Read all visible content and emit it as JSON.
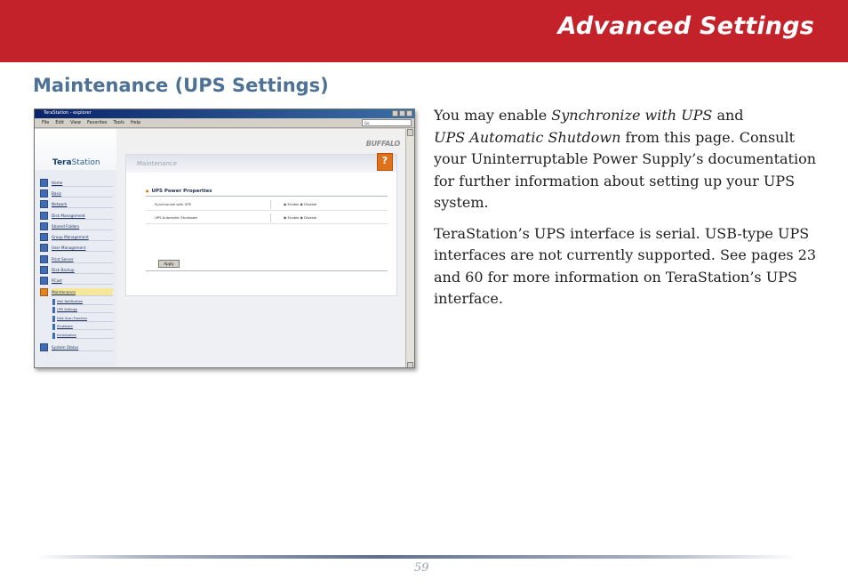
{
  "header": {
    "title": "Advanced Settings",
    "color": "#c4222b"
  },
  "section": {
    "title": "Maintenance (UPS Settings)"
  },
  "body": {
    "p1": {
      "t1": "You may enable ",
      "i1": "Synchronize with UPS",
      "t2": " and",
      "i2": "UPS Automatic Shutdown",
      "t3": " from this page. Consult your Uninterruptable Power Supply’s documentation for further information about setting up your UPS system."
    },
    "p2": "TeraStation’s UPS interface is serial.  USB-type UPS interfaces are not currently supported.  See pages 23 and 60 for more information on TeraStation’s UPS interface."
  },
  "footer": {
    "page_number": "59"
  },
  "screenshot": {
    "window_title": "TeraStation - explorer",
    "menus": [
      "File",
      "Edit",
      "View",
      "Favorites",
      "Tools",
      "Help"
    ],
    "goto_label": "Go",
    "brand": "BUFFALO",
    "product_prefix": "Tera",
    "product_suffix": "Station",
    "page_heading": "Maintenance",
    "help_glyph": "?",
    "nav": [
      {
        "label": "Home"
      },
      {
        "label": "Basic"
      },
      {
        "label": "Network"
      },
      {
        "label": "Disk Management"
      },
      {
        "label": "Shared Folders"
      },
      {
        "label": "Group Management"
      },
      {
        "label": "User Management"
      },
      {
        "label": "Print Server"
      },
      {
        "label": "Disk Backup"
      },
      {
        "label": "PCast"
      },
      {
        "label": "Maintenance"
      }
    ],
    "subnav": [
      {
        "label": "Mail Notification"
      },
      {
        "label": "UPS Settings"
      },
      {
        "label": "Disk Scan Function"
      },
      {
        "label": "Shutdown"
      },
      {
        "label": "Initialization"
      }
    ],
    "nav_last": "System Status",
    "panel": {
      "section_title": "UPS Power Properties",
      "rows": [
        {
          "label": "Synchronize with UPS",
          "options": "◉ Enable  ◉ Disable"
        },
        {
          "label": "UPS Automatic Shutdown",
          "options": "◉ Enable  ◉ Disable"
        }
      ],
      "apply_label": "Apply"
    }
  }
}
